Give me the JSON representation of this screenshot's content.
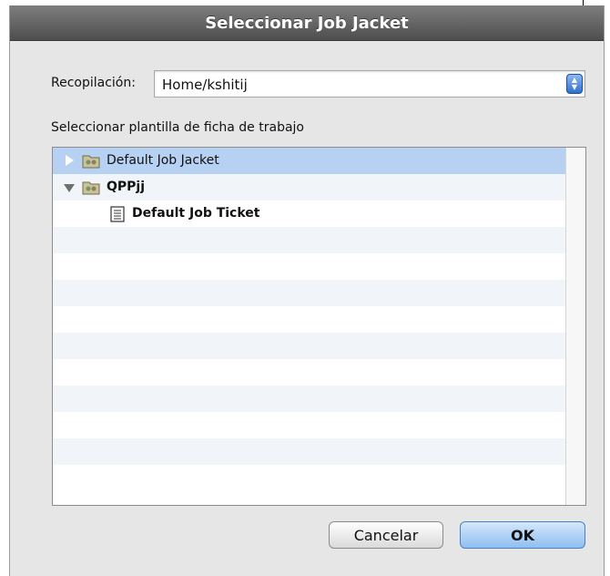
{
  "dialog": {
    "title": "Seleccionar Job Jacket"
  },
  "collection": {
    "label": "Recopilación:",
    "value": "Home/kshitij"
  },
  "template_section_label": "Seleccionar plantilla de ficha de trabajo",
  "tree": {
    "items": [
      {
        "label": "Default Job Jacket",
        "level": 0,
        "expanded": false,
        "selected": true,
        "icon": "job-jacket-folder-icon"
      },
      {
        "label": "QPPjj",
        "level": 0,
        "expanded": true,
        "selected": false,
        "icon": "job-jacket-folder-icon"
      },
      {
        "label": "Default Job Ticket",
        "level": 1,
        "selected": false,
        "icon": "job-ticket-icon"
      }
    ]
  },
  "buttons": {
    "cancel_label": "Cancelar",
    "ok_label": "OK"
  },
  "colors": {
    "selection": "#b7d1f3",
    "accent": "#2f6fd1",
    "titlebar": "#5e5e5e"
  }
}
